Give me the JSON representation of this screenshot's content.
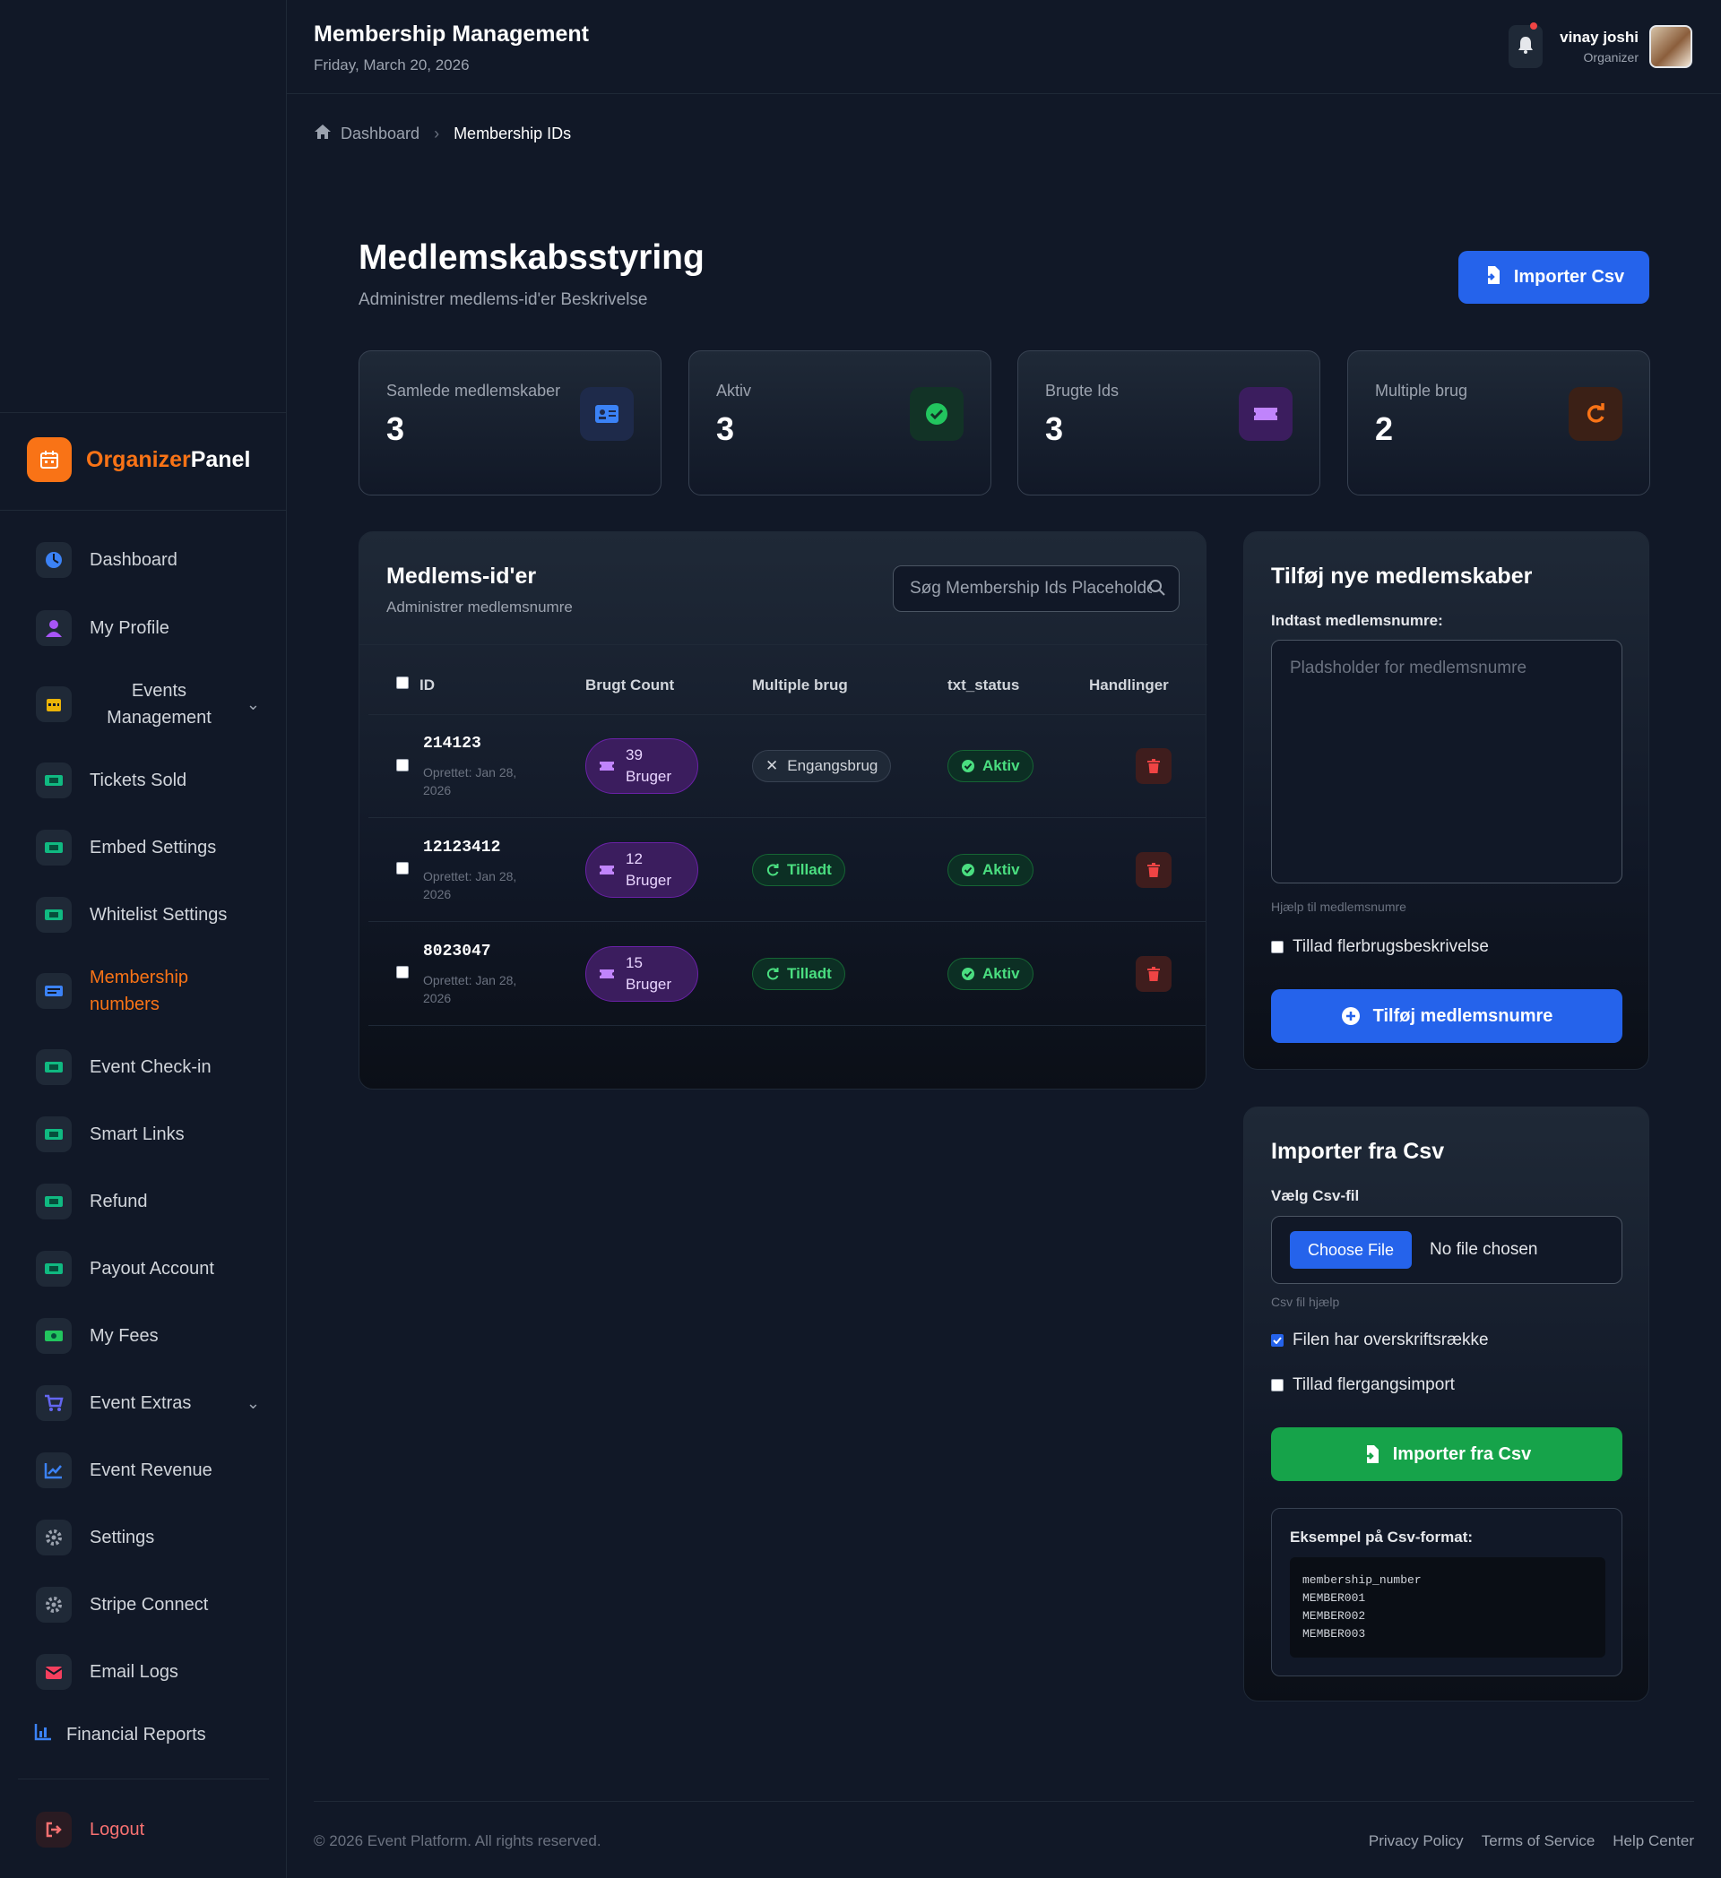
{
  "header": {
    "title": "Membership Management",
    "date": "Friday, March 20, 2026",
    "user_name": "vinay joshi",
    "user_role": "Organizer"
  },
  "brand": {
    "part1": "Organizer",
    "part2": "Panel"
  },
  "sidebar": {
    "items": [
      {
        "label": "Dashboard",
        "icon": "dashboard-icon"
      },
      {
        "label": "My Profile",
        "icon": "user-icon"
      },
      {
        "label": "Events Management",
        "icon": "calendar-icon"
      },
      {
        "label": "Tickets Sold",
        "icon": "ticket-icon"
      },
      {
        "label": "Embed Settings",
        "icon": "ticket-icon"
      },
      {
        "label": "Whitelist Settings",
        "icon": "ticket-icon"
      },
      {
        "label": "Membership numbers",
        "icon": "id-card-icon",
        "active": true
      },
      {
        "label": "Event Check-in",
        "icon": "ticket-icon"
      },
      {
        "label": "Smart Links",
        "icon": "ticket-icon"
      },
      {
        "label": "Refund",
        "icon": "ticket-icon"
      },
      {
        "label": "Payout Account",
        "icon": "ticket-icon"
      },
      {
        "label": "My Fees",
        "icon": "money-icon"
      },
      {
        "label": "Event Extras",
        "icon": "cart-icon"
      },
      {
        "label": "Event Revenue",
        "icon": "chart-line-icon"
      },
      {
        "label": "Settings",
        "icon": "gear-icon"
      },
      {
        "label": "Stripe Connect",
        "icon": "gear-icon"
      },
      {
        "label": "Email Logs",
        "icon": "mail-icon"
      },
      {
        "label": "Financial Reports",
        "icon": "bar-chart-icon"
      }
    ],
    "logout": "Logout"
  },
  "breadcrumb": {
    "home": "Dashboard",
    "current": "Membership IDs"
  },
  "page": {
    "title": "Medlemskabsstyring",
    "subtitle": "Administrer medlems-id'er Beskrivelse",
    "import_button": "Importer Csv"
  },
  "stats": [
    {
      "label": "Samlede medlemskaber",
      "value": "3",
      "color": "#3b82f6"
    },
    {
      "label": "Aktiv",
      "value": "3",
      "color": "#22c55e"
    },
    {
      "label": "Brugte Ids",
      "value": "3",
      "color": "#a855f7"
    },
    {
      "label": "Multiple brug",
      "value": "2",
      "color": "#f97316"
    }
  ],
  "members_panel": {
    "title": "Medlems-id'er",
    "subtitle": "Administrer medlemsnumre",
    "search_placeholder": "Søg Membership Ids Placeholder",
    "columns": [
      "ID",
      "Brugt Count",
      "Multiple brug",
      "txt_status",
      "Handlinger"
    ],
    "rows": [
      {
        "id": "214123",
        "created": "Oprettet: Jan 28, 2026",
        "count": "39",
        "count_unit": "Bruger",
        "multiple": "Engangsbrug",
        "multiple_kind": "single",
        "status": "Aktiv"
      },
      {
        "id": "12123412",
        "created": "Oprettet: Jan 28, 2026",
        "count": "12",
        "count_unit": "Bruger",
        "multiple": "Tilladt",
        "multiple_kind": "allowed",
        "status": "Aktiv"
      },
      {
        "id": "8023047",
        "created": "Oprettet: Jan 28, 2026",
        "count": "15",
        "count_unit": "Bruger",
        "multiple": "Tilladt",
        "multiple_kind": "allowed",
        "status": "Aktiv"
      }
    ]
  },
  "add_panel": {
    "title": "Tilføj nye medlemskaber",
    "label": "Indtast medlemsnumre:",
    "placeholder": "Pladsholder for medlemsnumre",
    "help": "Hjælp til medlemsnumre",
    "checkbox": "Tillad flerbrugsbeskrivelse",
    "button": "Tilføj medlemsnumre"
  },
  "import_panel": {
    "title": "Importer fra Csv",
    "label": "Vælg Csv-fil",
    "file_button": "Choose File",
    "file_status": "No file chosen",
    "help": "Csv fil hjælp",
    "checkbox_header": "Filen har overskriftsrække",
    "checkbox_header_checked": true,
    "checkbox_multi": "Tillad flergangsimport",
    "button": "Importer fra Csv",
    "example_title": "Eksempel på Csv-format:",
    "example_code": "membership_number\nMEMBER001\nMEMBER002\nMEMBER003"
  },
  "footer": {
    "copyright": "© 2026 Event Platform. All rights reserved.",
    "links": [
      "Privacy Policy",
      "Terms of Service",
      "Help Center"
    ]
  }
}
